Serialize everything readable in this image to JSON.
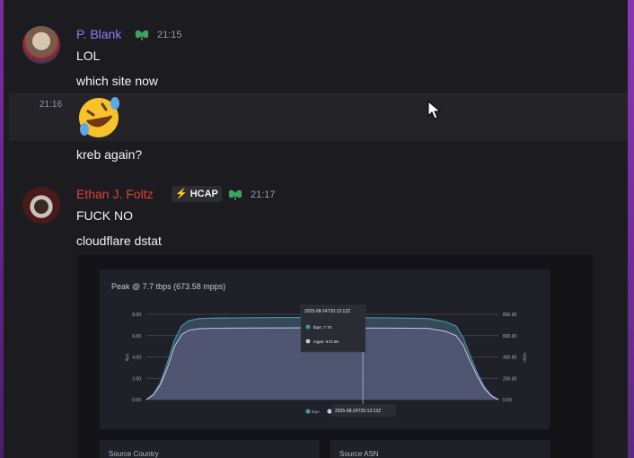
{
  "messages": [
    {
      "author": "P. Blank",
      "author_color": "#8d7ef3",
      "time": "21:15",
      "lines": [
        "LOL",
        "which site now"
      ]
    },
    {
      "time": "21:16",
      "emoji": "rolling-on-floor-laughing",
      "lines": [
        "kreb again?"
      ]
    },
    {
      "author": "Ethan J. Foltz",
      "author_color": "#e0403a",
      "time": "21:17",
      "tag": "HCAP",
      "lines": [
        "FUCK NO",
        "cloudflare dstat"
      ]
    }
  ],
  "embed": {
    "title": "Peak @ 7.7 tbps (673.58 mpps)",
    "tooltip": {
      "date": "2025-08-24T20:12:12Z",
      "tbps_label": "tbps:",
      "tbps_value": "7.70",
      "mpps_label": "mpps:",
      "mpps_value": "673.58"
    },
    "footer_date": "2025-08-24T20:12:12Z",
    "legend": [
      "tbps",
      "mpps"
    ],
    "panels": [
      "Source Country",
      "Source ASN"
    ]
  },
  "chart_data": {
    "type": "area",
    "left_axis": {
      "label": "tbps",
      "ticks": [
        "0.00",
        "2.00",
        "4.00",
        "6.00",
        "8.00"
      ],
      "ylim": [
        0,
        8
      ]
    },
    "right_axis": {
      "label": "mpps",
      "ticks": [
        "0.00",
        "200.00",
        "400.00",
        "600.00",
        "800.00"
      ],
      "ylim": [
        0,
        800
      ]
    },
    "grid": true,
    "series": [
      {
        "name": "tbps",
        "color": "#4b8fa8",
        "x": [
          0,
          2,
          4,
          6,
          8,
          10,
          12,
          15,
          20,
          30,
          40,
          50,
          60,
          70,
          80,
          85,
          88,
          90,
          92,
          94,
          96,
          98,
          100
        ],
        "values": [
          0,
          0.5,
          1.6,
          3.5,
          5.6,
          6.9,
          7.4,
          7.6,
          7.65,
          7.68,
          7.7,
          7.7,
          7.68,
          7.67,
          7.6,
          7.3,
          6.9,
          5.8,
          4.1,
          2.5,
          1.2,
          0.4,
          0
        ]
      },
      {
        "name": "mpps",
        "color": "#8a84b8",
        "x": [
          0,
          2,
          4,
          6,
          8,
          10,
          12,
          15,
          20,
          30,
          40,
          50,
          60,
          70,
          80,
          85,
          88,
          90,
          92,
          94,
          96,
          98,
          100
        ],
        "values": [
          0,
          45,
          140,
          300,
          500,
          610,
          650,
          665,
          670,
          672,
          673,
          673.58,
          672,
          671,
          668,
          640,
          600,
          510,
          360,
          220,
          105,
          35,
          0
        ]
      }
    ]
  }
}
